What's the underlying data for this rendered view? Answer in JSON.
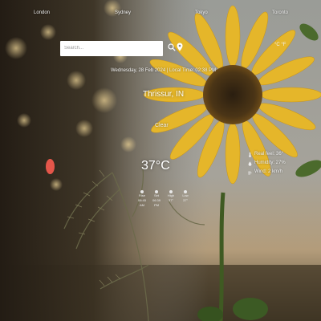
{
  "header": {
    "cities": [
      {
        "label": "London"
      },
      {
        "label": "Sydney"
      },
      {
        "label": "Tokyo"
      },
      {
        "label": "Toronto"
      }
    ]
  },
  "search": {
    "placeholder": "Search...",
    "value": ""
  },
  "units": {
    "label": "°C  °F"
  },
  "weather": {
    "datetime": "Wednesday, 28 Feb 2024 | Local Time: 02:38 PM",
    "location": "Thrissur, IN",
    "condition": "Clear",
    "temperature": "37°C",
    "details": [
      {
        "icon": "thermometer-icon",
        "text": "Real feel: 36°"
      },
      {
        "icon": "humidity-icon",
        "text": "Humidity: 27%"
      },
      {
        "icon": "wind-icon",
        "text": "Wind: 2 km/h"
      }
    ],
    "forecast": [
      {
        "time": "Rise",
        "value": "06:45 AM"
      },
      {
        "time": "Set",
        "value": "06:39 PM"
      },
      {
        "time": "High",
        "value": "37°"
      },
      {
        "time": "Low",
        "value": "37°"
      }
    ]
  },
  "colors": {
    "accent_dot": "#e4564a",
    "search_bg": "#ffffff"
  }
}
